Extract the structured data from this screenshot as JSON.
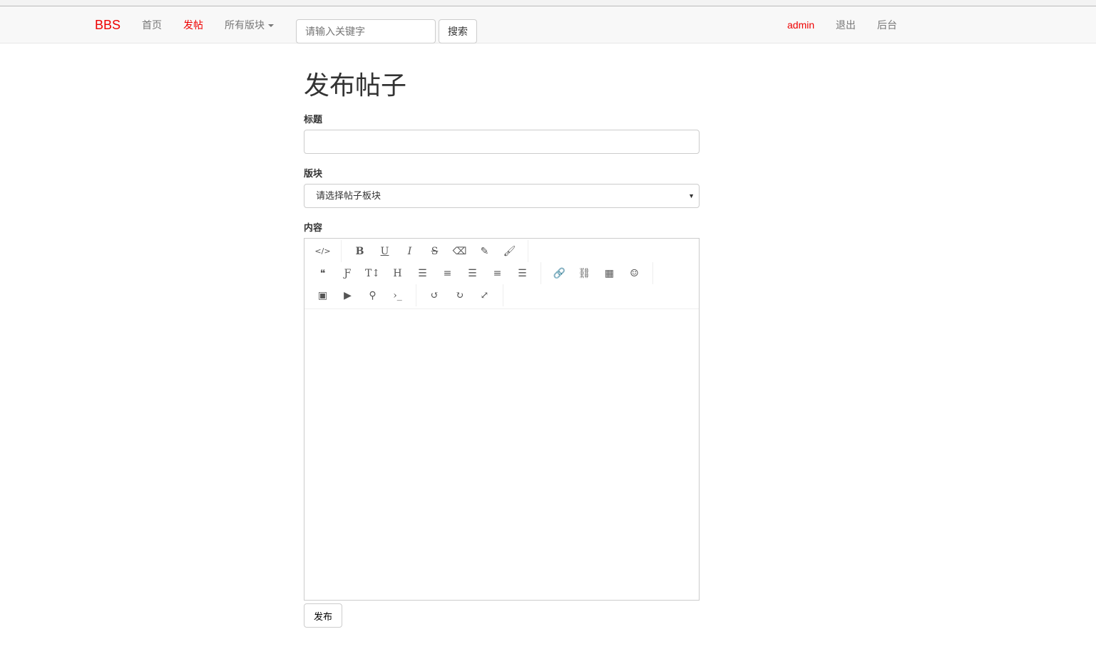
{
  "nav": {
    "brand": "BBS",
    "home": "首页",
    "post": "发帖",
    "boards": "所有版块",
    "search_placeholder": "请输入关键字",
    "search_button": "搜索",
    "user": "admin",
    "logout": "退出",
    "admin": "后台"
  },
  "page": {
    "title": "发布帖子",
    "title_label": "标题",
    "title_value": "",
    "board_label": "版块",
    "board_selected": "请选择帖子板块",
    "content_label": "内容",
    "submit": "发布"
  },
  "toolbar": {
    "row1": [
      [
        "code",
        "</>"
      ],
      [
        "bold",
        "B"
      ],
      [
        "underline",
        "U"
      ],
      [
        "italic",
        "I"
      ],
      [
        "strikethrough",
        "S"
      ],
      [
        "eraser",
        "⌫"
      ],
      [
        "pencil",
        "✎"
      ],
      [
        "brush",
        "🖌"
      ]
    ],
    "row2": [
      [
        "quote",
        "❝"
      ],
      [
        "font",
        "Ƒ"
      ],
      [
        "text-height",
        "T↕"
      ],
      [
        "heading",
        "H"
      ],
      [
        "unordered-list",
        "☰"
      ],
      [
        "ordered-list",
        "≡"
      ],
      [
        "align-left",
        "☰"
      ],
      [
        "align-center",
        "≡"
      ],
      [
        "align-right",
        "☰"
      ],
      [
        "link",
        "🔗"
      ],
      [
        "unlink",
        "⛓"
      ],
      [
        "table",
        "▦"
      ],
      [
        "emoji",
        "☺"
      ]
    ],
    "row3": [
      [
        "image",
        "▣"
      ],
      [
        "video",
        "▶"
      ],
      [
        "map-marker",
        "⚲"
      ],
      [
        "terminal",
        "›_"
      ],
      [
        "undo",
        "↺"
      ],
      [
        "redo",
        "↻"
      ],
      [
        "fullscreen",
        "⤢"
      ]
    ]
  }
}
